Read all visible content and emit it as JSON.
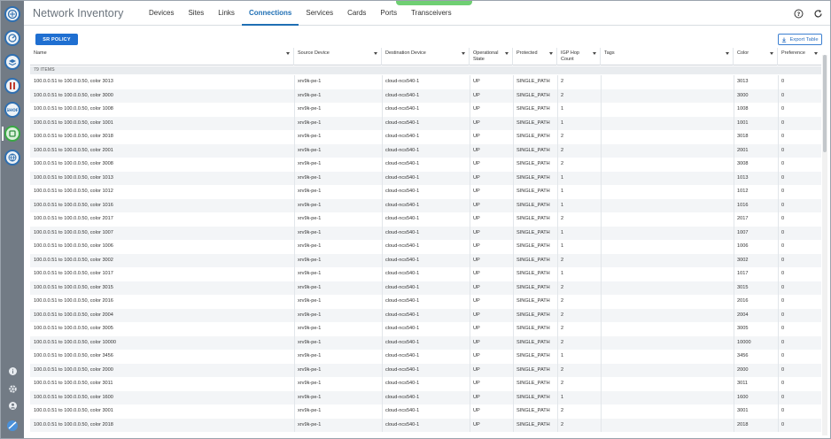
{
  "header": {
    "app_title": "Network Inventory",
    "tabs": [
      {
        "label": "Devices",
        "active": false
      },
      {
        "label": "Sites",
        "active": false
      },
      {
        "label": "Links",
        "active": false
      },
      {
        "label": "Connections",
        "active": true
      },
      {
        "label": "Services",
        "active": false
      },
      {
        "label": "Cards",
        "active": false
      },
      {
        "label": "Ports",
        "active": false
      },
      {
        "label": "Transceivers",
        "active": false
      }
    ]
  },
  "toolbar": {
    "sr_policy_label": "SR POLICY",
    "export_label": "Export Table"
  },
  "table": {
    "columns": [
      {
        "key": "name",
        "label": "Name",
        "sortable": true
      },
      {
        "key": "source",
        "label": "Source Device",
        "sortable": true
      },
      {
        "key": "dest",
        "label": "Destination Device",
        "sortable": true
      },
      {
        "key": "state",
        "label": "Operational State",
        "sortable": true
      },
      {
        "key": "protected",
        "label": "Protected",
        "sortable": true
      },
      {
        "key": "hops",
        "label": "IGP Hop Count",
        "sortable": true
      },
      {
        "key": "tags",
        "label": "Tags",
        "sortable": true
      },
      {
        "key": "color",
        "label": "Color",
        "sortable": true
      },
      {
        "key": "pref",
        "label": "Preference",
        "sortable": true
      }
    ],
    "item_count": "79 ITEMS",
    "rows": [
      {
        "name": "100.0.0.51 to 100.0.0.50, color 3013",
        "source": "xrv9k-pe-1",
        "dest": "cloud-ncs540-1",
        "state": "UP",
        "protected": "SINGLE_PATH",
        "hops": "2",
        "tags": "",
        "color": "3013",
        "pref": "0"
      },
      {
        "name": "100.0.0.51 to 100.0.0.50, color 3000",
        "source": "xrv9k-pe-1",
        "dest": "cloud-ncs540-1",
        "state": "UP",
        "protected": "SINGLE_PATH",
        "hops": "2",
        "tags": "",
        "color": "3000",
        "pref": "0"
      },
      {
        "name": "100.0.0.51 to 100.0.0.50, color 1008",
        "source": "xrv9k-pe-1",
        "dest": "cloud-ncs540-1",
        "state": "UP",
        "protected": "SINGLE_PATH",
        "hops": "1",
        "tags": "",
        "color": "1008",
        "pref": "0"
      },
      {
        "name": "100.0.0.51 to 100.0.0.50, color 1001",
        "source": "xrv9k-pe-1",
        "dest": "cloud-ncs540-1",
        "state": "UP",
        "protected": "SINGLE_PATH",
        "hops": "1",
        "tags": "",
        "color": "1001",
        "pref": "0"
      },
      {
        "name": "100.0.0.51 to 100.0.0.50, color 3018",
        "source": "xrv9k-pe-1",
        "dest": "cloud-ncs540-1",
        "state": "UP",
        "protected": "SINGLE_PATH",
        "hops": "2",
        "tags": "",
        "color": "3018",
        "pref": "0"
      },
      {
        "name": "100.0.0.51 to 100.0.0.50, color 2001",
        "source": "xrv9k-pe-1",
        "dest": "cloud-ncs540-1",
        "state": "UP",
        "protected": "SINGLE_PATH",
        "hops": "2",
        "tags": "",
        "color": "2001",
        "pref": "0"
      },
      {
        "name": "100.0.0.51 to 100.0.0.50, color 3008",
        "source": "xrv9k-pe-1",
        "dest": "cloud-ncs540-1",
        "state": "UP",
        "protected": "SINGLE_PATH",
        "hops": "2",
        "tags": "",
        "color": "3008",
        "pref": "0"
      },
      {
        "name": "100.0.0.51 to 100.0.0.50, color 1013",
        "source": "xrv9k-pe-1",
        "dest": "cloud-ncs540-1",
        "state": "UP",
        "protected": "SINGLE_PATH",
        "hops": "1",
        "tags": "",
        "color": "1013",
        "pref": "0"
      },
      {
        "name": "100.0.0.51 to 100.0.0.50, color 1012",
        "source": "xrv9k-pe-1",
        "dest": "cloud-ncs540-1",
        "state": "UP",
        "protected": "SINGLE_PATH",
        "hops": "1",
        "tags": "",
        "color": "1012",
        "pref": "0"
      },
      {
        "name": "100.0.0.51 to 100.0.0.50, color 1016",
        "source": "xrv9k-pe-1",
        "dest": "cloud-ncs540-1",
        "state": "UP",
        "protected": "SINGLE_PATH",
        "hops": "1",
        "tags": "",
        "color": "1016",
        "pref": "0"
      },
      {
        "name": "100.0.0.51 to 100.0.0.50, color 2017",
        "source": "xrv9k-pe-1",
        "dest": "cloud-ncs540-1",
        "state": "UP",
        "protected": "SINGLE_PATH",
        "hops": "2",
        "tags": "",
        "color": "2017",
        "pref": "0"
      },
      {
        "name": "100.0.0.51 to 100.0.0.50, color 1007",
        "source": "xrv9k-pe-1",
        "dest": "cloud-ncs540-1",
        "state": "UP",
        "protected": "SINGLE_PATH",
        "hops": "1",
        "tags": "",
        "color": "1007",
        "pref": "0"
      },
      {
        "name": "100.0.0.51 to 100.0.0.50, color 1006",
        "source": "xrv9k-pe-1",
        "dest": "cloud-ncs540-1",
        "state": "UP",
        "protected": "SINGLE_PATH",
        "hops": "1",
        "tags": "",
        "color": "1006",
        "pref": "0"
      },
      {
        "name": "100.0.0.51 to 100.0.0.50, color 3002",
        "source": "xrv9k-pe-1",
        "dest": "cloud-ncs540-1",
        "state": "UP",
        "protected": "SINGLE_PATH",
        "hops": "2",
        "tags": "",
        "color": "3002",
        "pref": "0"
      },
      {
        "name": "100.0.0.51 to 100.0.0.50, color 1017",
        "source": "xrv9k-pe-1",
        "dest": "cloud-ncs540-1",
        "state": "UP",
        "protected": "SINGLE_PATH",
        "hops": "1",
        "tags": "",
        "color": "1017",
        "pref": "0"
      },
      {
        "name": "100.0.0.51 to 100.0.0.50, color 3015",
        "source": "xrv9k-pe-1",
        "dest": "cloud-ncs540-1",
        "state": "UP",
        "protected": "SINGLE_PATH",
        "hops": "2",
        "tags": "",
        "color": "3015",
        "pref": "0"
      },
      {
        "name": "100.0.0.51 to 100.0.0.50, color 2016",
        "source": "xrv9k-pe-1",
        "dest": "cloud-ncs540-1",
        "state": "UP",
        "protected": "SINGLE_PATH",
        "hops": "2",
        "tags": "",
        "color": "2016",
        "pref": "0"
      },
      {
        "name": "100.0.0.51 to 100.0.0.50, color 2004",
        "source": "xrv9k-pe-1",
        "dest": "cloud-ncs540-1",
        "state": "UP",
        "protected": "SINGLE_PATH",
        "hops": "2",
        "tags": "",
        "color": "2004",
        "pref": "0"
      },
      {
        "name": "100.0.0.51 to 100.0.0.50, color 3005",
        "source": "xrv9k-pe-1",
        "dest": "cloud-ncs540-1",
        "state": "UP",
        "protected": "SINGLE_PATH",
        "hops": "2",
        "tags": "",
        "color": "3005",
        "pref": "0"
      },
      {
        "name": "100.0.0.51 to 100.0.0.50, color 10000",
        "source": "xrv9k-pe-1",
        "dest": "cloud-ncs540-1",
        "state": "UP",
        "protected": "SINGLE_PATH",
        "hops": "2",
        "tags": "",
        "color": "10000",
        "pref": "0"
      },
      {
        "name": "100.0.0.51 to 100.0.0.50, color 3456",
        "source": "xrv9k-pe-1",
        "dest": "cloud-ncs540-1",
        "state": "UP",
        "protected": "SINGLE_PATH",
        "hops": "1",
        "tags": "",
        "color": "3456",
        "pref": "0"
      },
      {
        "name": "100.0.0.51 to 100.0.0.50, color 2000",
        "source": "xrv9k-pe-1",
        "dest": "cloud-ncs540-1",
        "state": "UP",
        "protected": "SINGLE_PATH",
        "hops": "2",
        "tags": "",
        "color": "2000",
        "pref": "0"
      },
      {
        "name": "100.0.0.51 to 100.0.0.50, color 3011",
        "source": "xrv9k-pe-1",
        "dest": "cloud-ncs540-1",
        "state": "UP",
        "protected": "SINGLE_PATH",
        "hops": "2",
        "tags": "",
        "color": "3011",
        "pref": "0"
      },
      {
        "name": "100.0.0.51 to 100.0.0.50, color 1600",
        "source": "xrv9k-pe-1",
        "dest": "cloud-ncs540-1",
        "state": "UP",
        "protected": "SINGLE_PATH",
        "hops": "1",
        "tags": "",
        "color": "1600",
        "pref": "0"
      },
      {
        "name": "100.0.0.51 to 100.0.0.50, color 3001",
        "source": "xrv9k-pe-1",
        "dest": "cloud-ncs540-1",
        "state": "UP",
        "protected": "SINGLE_PATH",
        "hops": "2",
        "tags": "",
        "color": "3001",
        "pref": "0"
      },
      {
        "name": "100.0.0.51 to 100.0.0.50, color 2018",
        "source": "xrv9k-pe-1",
        "dest": "cloud-ncs540-1",
        "state": "UP",
        "protected": "SINGLE_PATH",
        "hops": "2",
        "tags": "",
        "color": "2018",
        "pref": "0"
      }
    ]
  },
  "rail": {
    "icons": [
      "cisco-logo-icon",
      "dashboard-icon",
      "layers-icon",
      "tools-icon",
      "shop-icon",
      "inventory-icon",
      "globe-icon"
    ],
    "bottom_icons": [
      "info-icon",
      "gear-icon",
      "user-icon",
      "brand-icon"
    ]
  },
  "colors": {
    "accent": "#1f6fb4",
    "primary_button": "#1f6fd1",
    "rail": "#727b85",
    "status_accent": "#6fcf73"
  }
}
